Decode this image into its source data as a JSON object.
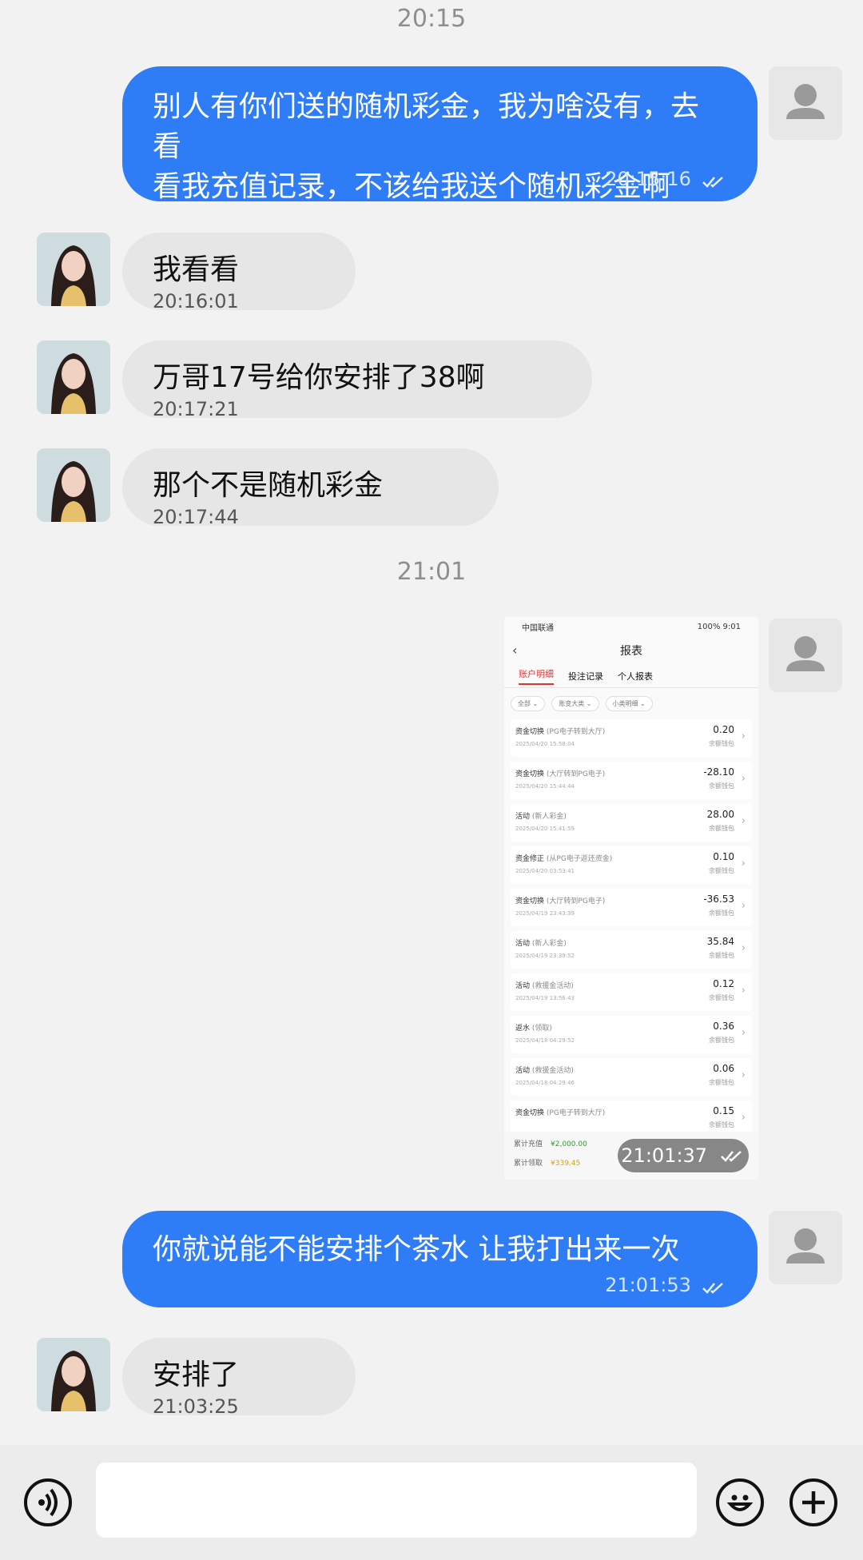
{
  "timestamps": [
    "20:15",
    "21:01"
  ],
  "messages": [
    {
      "text_lines": [
        "别人有你们送的随机彩金，我为啥没有，去看",
        "看我充值记录，不该给我送个随机彩金啊"
      ],
      "time": "20:15:16"
    },
    {
      "text": "我看看",
      "time": "20:16:01"
    },
    {
      "text": "万哥17号给你安排了38啊",
      "time": "20:17:21"
    },
    {
      "text": "那个不是随机彩金",
      "time": "20:17:44"
    },
    {
      "text": "你就说能不能安排个茶水 让我打出来一次",
      "time": "21:01:53"
    },
    {
      "text": "安排了",
      "time": "21:03:25"
    }
  ],
  "screenshot_message": {
    "time": "21:01:37",
    "status_left": "中国联通",
    "status_right": "100% 9:01",
    "title": "报表",
    "tabs": [
      "账户明细",
      "投注记录",
      "个人报表"
    ],
    "filters": [
      "全部",
      "账变大类",
      "小类明细"
    ],
    "rows": [
      {
        "title": "资金切换",
        "note": "(PG电子转到大厅)",
        "date": "2025/04/20 15:58:04",
        "amount": "0.20",
        "wallet": "余额钱包"
      },
      {
        "title": "资金切换",
        "note": "(大厅转到PG电子)",
        "date": "2025/04/20 15:44:44",
        "amount": "-28.10",
        "wallet": "余额钱包"
      },
      {
        "title": "活动",
        "note": "(新人彩金)",
        "date": "2025/04/20 15:41:59",
        "amount": "28.00",
        "wallet": "余额钱包"
      },
      {
        "title": "资金修正",
        "note": "(从PG电子返还资金)",
        "date": "2025/04/20 03:53:41",
        "amount": "0.10",
        "wallet": "余额钱包"
      },
      {
        "title": "资金切换",
        "note": "(大厅转到PG电子)",
        "date": "2025/04/19 23:43:39",
        "amount": "-36.53",
        "wallet": "余额钱包"
      },
      {
        "title": "活动",
        "note": "(新人彩金)",
        "date": "2025/04/19 23:39:52",
        "amount": "35.84",
        "wallet": "余额钱包"
      },
      {
        "title": "活动",
        "note": "(救援金活动)",
        "date": "2025/04/19 13:56:43",
        "amount": "0.12",
        "wallet": "余额钱包"
      },
      {
        "title": "返水",
        "note": "(领取)",
        "date": "2025/04/18 04:29:52",
        "amount": "0.36",
        "wallet": "余额钱包"
      },
      {
        "title": "活动",
        "note": "(救援金活动)",
        "date": "2025/04/18 04:29:46",
        "amount": "0.06",
        "wallet": "余额钱包"
      },
      {
        "title": "资金切换",
        "note": "(PG电子转到大厅)",
        "date": "",
        "amount": "0.15",
        "wallet": "余额钱包"
      }
    ],
    "footer": {
      "recharge_label": "累计充值",
      "recharge_value": "¥2,000.00",
      "claim_label": "累计领取",
      "claim_value": "¥339.45"
    }
  },
  "input": {
    "placeholder": ""
  },
  "colors": {
    "outgoing": "#2e7cf6",
    "incoming": "#e6e6e6",
    "background": "#f2f2f2"
  }
}
